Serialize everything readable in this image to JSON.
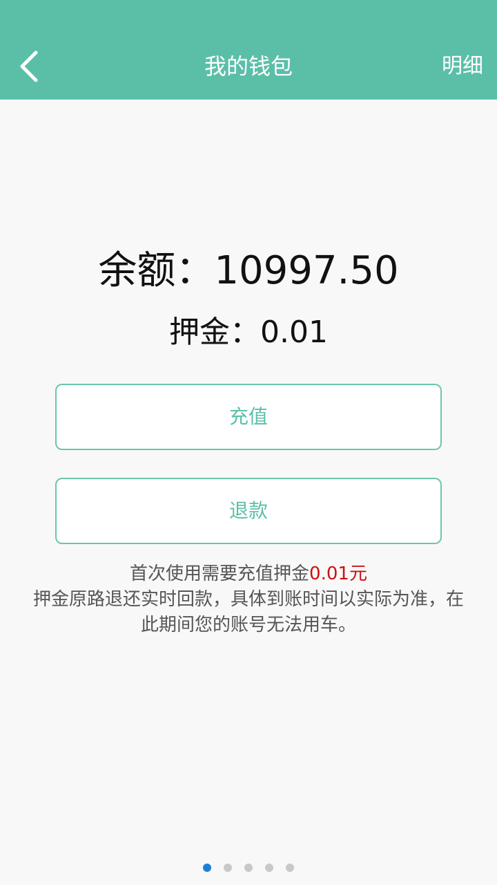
{
  "header": {
    "title": "我的钱包",
    "detail_label": "明细",
    "back_icon": "chevron-left-icon",
    "bg_color": "#5bbfa8"
  },
  "wallet": {
    "balance_text": "余额：10997.50",
    "deposit_text": "押金：0.01"
  },
  "buttons": {
    "recharge_label": "充值",
    "refund_label": "退款"
  },
  "notice": {
    "line1_prefix": "首次使用需要充值押金",
    "line1_amount": "0.01元",
    "line2": "押金原路退还实时回款，具体到账时间以实际为准，在此期间您的账号无法用车。"
  },
  "pager": {
    "total": 5,
    "active_index": 0
  },
  "colors": {
    "accent": "#5bbfa8",
    "highlight_red": "#cc1111",
    "active_dot": "#1b7fd6"
  }
}
